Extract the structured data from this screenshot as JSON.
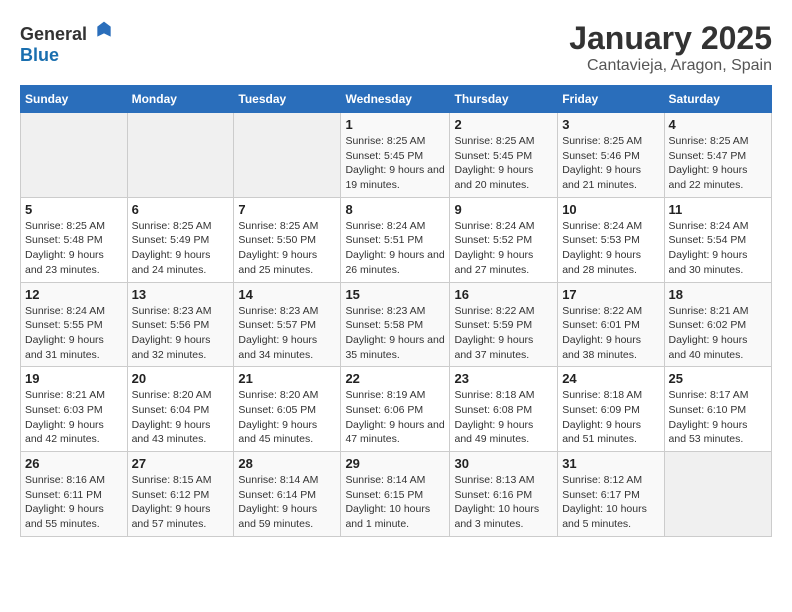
{
  "header": {
    "logo_general": "General",
    "logo_blue": "Blue",
    "month": "January 2025",
    "location": "Cantavieja, Aragon, Spain"
  },
  "days_of_week": [
    "Sunday",
    "Monday",
    "Tuesday",
    "Wednesday",
    "Thursday",
    "Friday",
    "Saturday"
  ],
  "weeks": [
    [
      {
        "day": "",
        "empty": true
      },
      {
        "day": "",
        "empty": true
      },
      {
        "day": "",
        "empty": true
      },
      {
        "day": "1",
        "sunrise": "8:25 AM",
        "sunset": "5:45 PM",
        "daylight": "9 hours and 19 minutes."
      },
      {
        "day": "2",
        "sunrise": "8:25 AM",
        "sunset": "5:45 PM",
        "daylight": "9 hours and 20 minutes."
      },
      {
        "day": "3",
        "sunrise": "8:25 AM",
        "sunset": "5:46 PM",
        "daylight": "9 hours and 21 minutes."
      },
      {
        "day": "4",
        "sunrise": "8:25 AM",
        "sunset": "5:47 PM",
        "daylight": "9 hours and 22 minutes."
      }
    ],
    [
      {
        "day": "5",
        "sunrise": "8:25 AM",
        "sunset": "5:48 PM",
        "daylight": "9 hours and 23 minutes."
      },
      {
        "day": "6",
        "sunrise": "8:25 AM",
        "sunset": "5:49 PM",
        "daylight": "9 hours and 24 minutes."
      },
      {
        "day": "7",
        "sunrise": "8:25 AM",
        "sunset": "5:50 PM",
        "daylight": "9 hours and 25 minutes."
      },
      {
        "day": "8",
        "sunrise": "8:24 AM",
        "sunset": "5:51 PM",
        "daylight": "9 hours and 26 minutes."
      },
      {
        "day": "9",
        "sunrise": "8:24 AM",
        "sunset": "5:52 PM",
        "daylight": "9 hours and 27 minutes."
      },
      {
        "day": "10",
        "sunrise": "8:24 AM",
        "sunset": "5:53 PM",
        "daylight": "9 hours and 28 minutes."
      },
      {
        "day": "11",
        "sunrise": "8:24 AM",
        "sunset": "5:54 PM",
        "daylight": "9 hours and 30 minutes."
      }
    ],
    [
      {
        "day": "12",
        "sunrise": "8:24 AM",
        "sunset": "5:55 PM",
        "daylight": "9 hours and 31 minutes."
      },
      {
        "day": "13",
        "sunrise": "8:23 AM",
        "sunset": "5:56 PM",
        "daylight": "9 hours and 32 minutes."
      },
      {
        "day": "14",
        "sunrise": "8:23 AM",
        "sunset": "5:57 PM",
        "daylight": "9 hours and 34 minutes."
      },
      {
        "day": "15",
        "sunrise": "8:23 AM",
        "sunset": "5:58 PM",
        "daylight": "9 hours and 35 minutes."
      },
      {
        "day": "16",
        "sunrise": "8:22 AM",
        "sunset": "5:59 PM",
        "daylight": "9 hours and 37 minutes."
      },
      {
        "day": "17",
        "sunrise": "8:22 AM",
        "sunset": "6:01 PM",
        "daylight": "9 hours and 38 minutes."
      },
      {
        "day": "18",
        "sunrise": "8:21 AM",
        "sunset": "6:02 PM",
        "daylight": "9 hours and 40 minutes."
      }
    ],
    [
      {
        "day": "19",
        "sunrise": "8:21 AM",
        "sunset": "6:03 PM",
        "daylight": "9 hours and 42 minutes."
      },
      {
        "day": "20",
        "sunrise": "8:20 AM",
        "sunset": "6:04 PM",
        "daylight": "9 hours and 43 minutes."
      },
      {
        "day": "21",
        "sunrise": "8:20 AM",
        "sunset": "6:05 PM",
        "daylight": "9 hours and 45 minutes."
      },
      {
        "day": "22",
        "sunrise": "8:19 AM",
        "sunset": "6:06 PM",
        "daylight": "9 hours and 47 minutes."
      },
      {
        "day": "23",
        "sunrise": "8:18 AM",
        "sunset": "6:08 PM",
        "daylight": "9 hours and 49 minutes."
      },
      {
        "day": "24",
        "sunrise": "8:18 AM",
        "sunset": "6:09 PM",
        "daylight": "9 hours and 51 minutes."
      },
      {
        "day": "25",
        "sunrise": "8:17 AM",
        "sunset": "6:10 PM",
        "daylight": "9 hours and 53 minutes."
      }
    ],
    [
      {
        "day": "26",
        "sunrise": "8:16 AM",
        "sunset": "6:11 PM",
        "daylight": "9 hours and 55 minutes."
      },
      {
        "day": "27",
        "sunrise": "8:15 AM",
        "sunset": "6:12 PM",
        "daylight": "9 hours and 57 minutes."
      },
      {
        "day": "28",
        "sunrise": "8:14 AM",
        "sunset": "6:14 PM",
        "daylight": "9 hours and 59 minutes."
      },
      {
        "day": "29",
        "sunrise": "8:14 AM",
        "sunset": "6:15 PM",
        "daylight": "10 hours and 1 minute."
      },
      {
        "day": "30",
        "sunrise": "8:13 AM",
        "sunset": "6:16 PM",
        "daylight": "10 hours and 3 minutes."
      },
      {
        "day": "31",
        "sunrise": "8:12 AM",
        "sunset": "6:17 PM",
        "daylight": "10 hours and 5 minutes."
      },
      {
        "day": "",
        "empty": true
      }
    ]
  ]
}
